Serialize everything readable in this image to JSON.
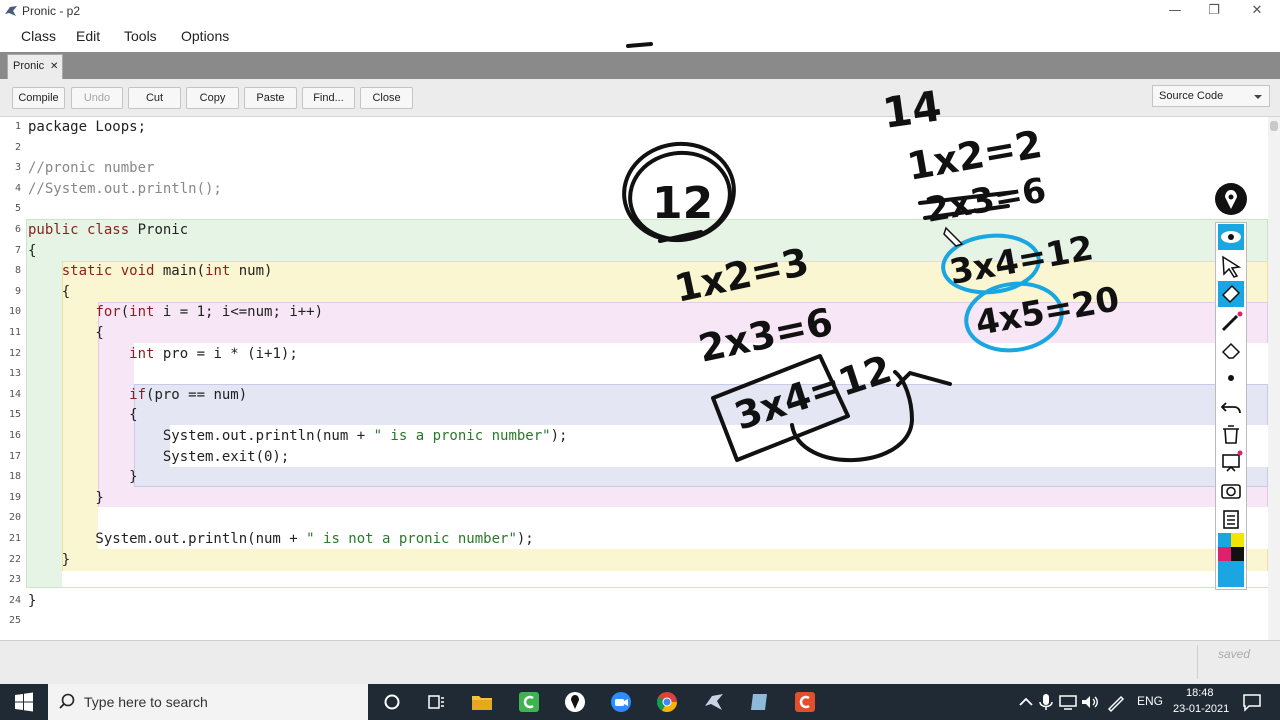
{
  "window": {
    "title": "Pronic - p2",
    "minimize": "—",
    "restore": "❐",
    "close": "✕"
  },
  "menu": [
    "Class",
    "Edit",
    "Tools",
    "Options"
  ],
  "tab": {
    "label": "Pronic",
    "close": "✕"
  },
  "toolbar": {
    "buttons": [
      {
        "label": "Compile",
        "enabled": true
      },
      {
        "label": "Undo",
        "enabled": false
      },
      {
        "label": "Cut",
        "enabled": true
      },
      {
        "label": "Copy",
        "enabled": true
      },
      {
        "label": "Paste",
        "enabled": true
      },
      {
        "label": "Find...",
        "enabled": true
      },
      {
        "label": "Close",
        "enabled": true
      }
    ],
    "view_select": "Source Code"
  },
  "code_lines": [
    [
      {
        "t": "package Loops;"
      }
    ],
    [],
    [
      {
        "t": "//pronic number",
        "c": "com"
      }
    ],
    [
      {
        "t": "//System.out.println();",
        "c": "com"
      }
    ],
    [],
    [
      {
        "t": "public class",
        "c": "kw"
      },
      {
        "t": " Pronic"
      }
    ],
    [
      {
        "t": "{"
      }
    ],
    [
      {
        "t": "    "
      },
      {
        "t": "static void",
        "c": "kw"
      },
      {
        "t": " main("
      },
      {
        "t": "int",
        "c": "kw"
      },
      {
        "t": " num)"
      }
    ],
    [
      {
        "t": "    {"
      }
    ],
    [
      {
        "t": "        "
      },
      {
        "t": "for",
        "c": "kw"
      },
      {
        "t": "("
      },
      {
        "t": "int",
        "c": "kw"
      },
      {
        "t": " i = 1; i<=num; i++)"
      }
    ],
    [
      {
        "t": "        {"
      }
    ],
    [
      {
        "t": "            "
      },
      {
        "t": "int",
        "c": "kw"
      },
      {
        "t": " pro = i * (i+1);"
      }
    ],
    [],
    [
      {
        "t": "            "
      },
      {
        "t": "if",
        "c": "kw"
      },
      {
        "t": "(pro == num)"
      }
    ],
    [
      {
        "t": "            {"
      }
    ],
    [
      {
        "t": "                System.out.println(num + "
      },
      {
        "t": "\" is a pronic number\"",
        "c": "str"
      },
      {
        "t": ");"
      }
    ],
    [
      {
        "t": "                System.exit(0);"
      }
    ],
    [
      {
        "t": "            }"
      }
    ],
    [
      {
        "t": "        }"
      }
    ],
    [],
    [
      {
        "t": "        System.out.println(num + "
      },
      {
        "t": "\" is not a pronic number\"",
        "c": "str"
      },
      {
        "t": ");"
      }
    ],
    [
      {
        "t": "    }"
      }
    ],
    [],
    [
      {
        "t": "}"
      }
    ],
    []
  ],
  "annotations": {
    "circled": "12",
    "top": "14",
    "right": [
      "1x2=2",
      "2x3=6",
      "3x4=12",
      "4x5=20"
    ],
    "middle": [
      "1x2=3",
      "2x3=6",
      "3x4=12"
    ],
    "dash": "—"
  },
  "status": {
    "saved": "saved"
  },
  "taskbar": {
    "search_placeholder": "Type here to search",
    "language": "ENG",
    "time": "18:48",
    "date": "23-01-2021"
  },
  "colors": {
    "class_scope": "#e6f4e6",
    "method_scope": "#fbf6d2",
    "for_scope": "#f7e6f5",
    "if_scope": "#e4e6f4",
    "ink_black": "#111111",
    "ink_blue": "#1aa6e0",
    "keyword": "#8b1e1e",
    "comment": "#888888",
    "string": "#2a7a2a"
  }
}
